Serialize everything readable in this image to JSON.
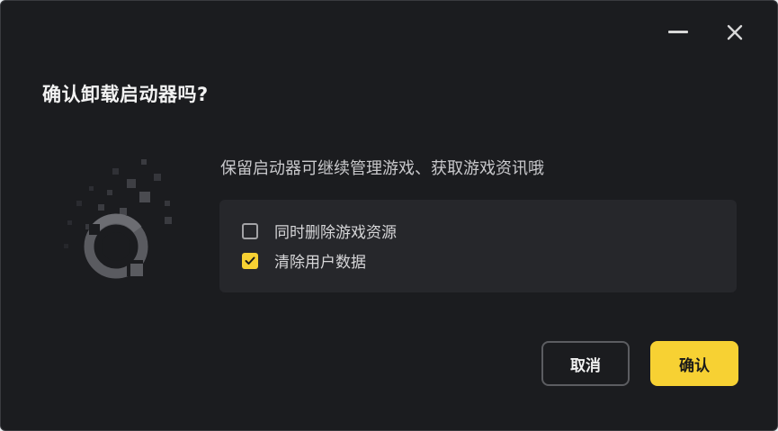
{
  "dialog": {
    "title": "确认卸载启动器吗?",
    "message": "保留启动器可继续管理游戏、获取游戏资讯哦",
    "options": [
      {
        "label": "同时删除游戏资源",
        "checked": false
      },
      {
        "label": "清除用户数据",
        "checked": true
      }
    ],
    "buttons": {
      "cancel_label": "取消",
      "confirm_label": "确认"
    }
  },
  "titlebar": {
    "minimize_icon": "minimize-icon",
    "close_icon": "close-icon"
  },
  "colors": {
    "background": "#1b1c1f",
    "panel": "#26272b",
    "accent": "#f7d133",
    "text": "#f2f2f2",
    "muted_text": "#c9c9cc"
  }
}
